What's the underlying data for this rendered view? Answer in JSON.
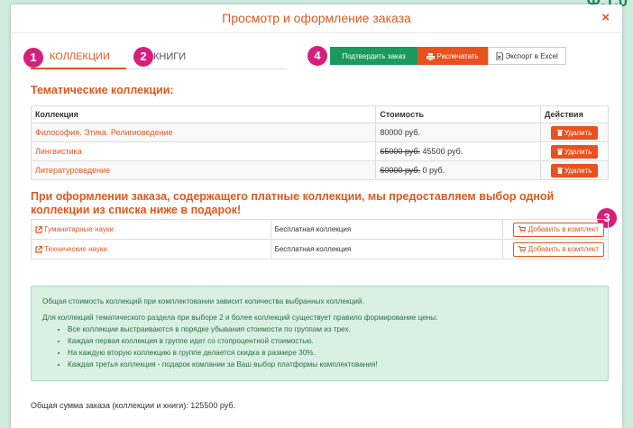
{
  "page_hint": "Ф.1.0",
  "modal": {
    "title": "Просмотр и оформление заказа",
    "close": "×"
  },
  "tabs": [
    {
      "label": "КОЛЛЕКЦИИ",
      "active": true,
      "badge": "1"
    },
    {
      "label": "КНИГИ",
      "active": false,
      "badge": "2"
    }
  ],
  "actions": {
    "badge": "4",
    "confirm": "Подтвердить заказ",
    "print": "Распечатать",
    "export": "Экспорт в Excel"
  },
  "thematic": {
    "title": "Тематические коллекции:",
    "columns": [
      "Коллекция",
      "Стоимость",
      "Действия"
    ],
    "rows": [
      {
        "name": "Философия. Этика. Религиоведение",
        "old_price": "",
        "price": "80000 руб.",
        "action": "Удалить"
      },
      {
        "name": "Лингвистика",
        "old_price": "65000 руб.",
        "price": "45500 руб.",
        "action": "Удалить"
      },
      {
        "name": "Литературоведение",
        "old_price": "60000 руб.",
        "price": "0 руб.",
        "action": "Удалить"
      }
    ]
  },
  "gift": {
    "title": "При оформлении заказа, содержащего платные коллекции, мы предоставляем выбор одной коллекции из списка ниже в подарок!",
    "badge": "3",
    "rows": [
      {
        "name": "Гуманитарные науки",
        "status": "Бесплатная коллекция",
        "action": "Добавить в комплект"
      },
      {
        "name": "Технические науки",
        "status": "Бесплатная коллекция",
        "action": "Добавить в комплект"
      }
    ]
  },
  "info": {
    "line1": "Общая стоимость коллекций при комплектовании зависит количества выбранных коллекций.",
    "line2": "Для коллекций тематического раздела при выборе 2 и более коллекций существует правило формирование цены:",
    "bullets": [
      "Все коллекции выстраиваются в порядке убывания стоимости по группам из трех.",
      "Каждая первая коллекция в группе идет со стопроцентной стоимостью.",
      "На каждую вторую коллекцию в группе делается скидка в размере 30%.",
      "Каждая третья коллекция - подарок компании за Ваш выбор платформы комплектования!"
    ]
  },
  "total": "Общая сумма заказа (коллекции и книги): 125500 руб.",
  "colors": {
    "accent": "#e0581f",
    "badge": "#d61f7a",
    "confirm": "#1b9a5d",
    "info_bg": "#d9f0e3"
  }
}
